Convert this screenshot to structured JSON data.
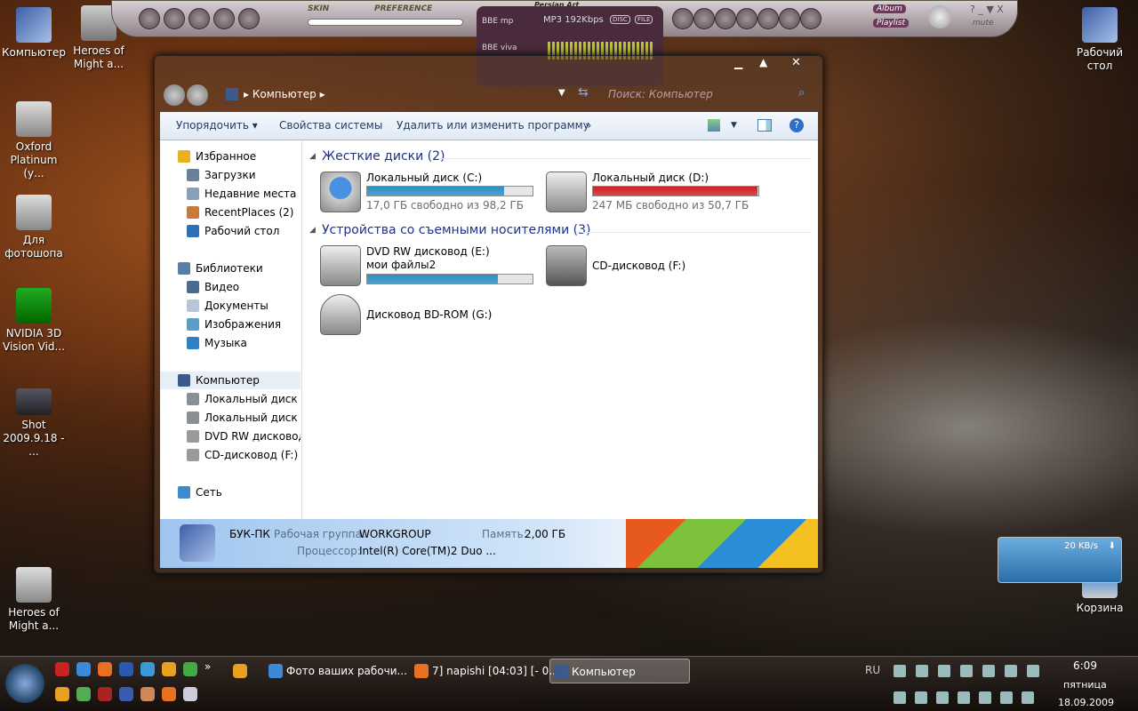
{
  "desktop": {
    "icons_left": [
      "Компьютер",
      "Oxford Platinum (у...",
      "Для фотошопа",
      "NVIDIA 3D Vision Vid...",
      "Shot 2009.9.18 - ...",
      "Heroes of Might a..."
    ],
    "icon_second": "Heroes of Might a...",
    "icons_right": [
      "Рабочий стол",
      "Корзина"
    ]
  },
  "player": {
    "skin": "SKIN",
    "preference": "PREFERENCE",
    "brand": "Persian Art",
    "bbe_mp": "BBE mp",
    "bbe_viva": "BBE viva",
    "format": "MP3 192Kbps",
    "disc": "DISC",
    "file": "FILE",
    "album": "Album",
    "playlist": "Playlist",
    "mute": "mute",
    "help": "? _ ▼ X"
  },
  "window": {
    "address": "Компьютер",
    "search_placeholder": "Поиск: Компьютер",
    "toolbar": {
      "organize": "Упорядочить ▾",
      "system_props": "Свойства системы",
      "uninstall": "Удалить или изменить программу",
      "more": "»"
    },
    "nav": [
      {
        "label": "Избранное",
        "icon": "star-icon",
        "color": "#e8b21e"
      },
      {
        "label": "Загрузки",
        "icon": "downloads-icon",
        "color": "#6b7f99"
      },
      {
        "label": "Недавние места",
        "icon": "recent-icon",
        "color": "#8aa0b8"
      },
      {
        "label": "RecentPlaces (2)",
        "icon": "recent-icon",
        "color": "#c77a3e"
      },
      {
        "label": "Рабочий стол",
        "icon": "desktop-icon",
        "color": "#2f6fb5"
      },
      {
        "label": "Библиотеки",
        "icon": "library-icon",
        "color": "#5a7da6"
      },
      {
        "label": "Видео",
        "icon": "video-icon",
        "color": "#4a6b8f"
      },
      {
        "label": "Документы",
        "icon": "documents-icon",
        "color": "#b9c6d6"
      },
      {
        "label": "Изображения",
        "icon": "pictures-icon",
        "color": "#5e9cc8"
      },
      {
        "label": "Музыка",
        "icon": "music-icon",
        "color": "#2f7fc4"
      },
      {
        "label": "Компьютер",
        "icon": "computer-icon",
        "color": "#3c5a8c"
      },
      {
        "label": "Локальный диск (C",
        "icon": "drive-icon",
        "color": "#8a8f96"
      },
      {
        "label": "Локальный диск (D",
        "icon": "drive-icon",
        "color": "#8a8f96"
      },
      {
        "label": "DVD RW дисковод (",
        "icon": "dvd-icon",
        "color": "#9a9a9a"
      },
      {
        "label": "CD-дисковод (F:)",
        "icon": "cd-icon",
        "color": "#9a9a9a"
      },
      {
        "label": "Сеть",
        "icon": "network-icon",
        "color": "#3d8ad0"
      }
    ],
    "groups": [
      {
        "title": "Жесткие диски (2)"
      },
      {
        "title": "Устройства со съемными носителями (3)"
      }
    ],
    "drives": [
      {
        "name": "Локальный диск (C:)",
        "free": "17,0 ГБ свободно из 98,2 ГБ",
        "used_fraction": 0.83,
        "bar_color": "#2a8fc4"
      },
      {
        "name": "Локальный диск (D:)",
        "free": "247 МБ свободно из 50,7 ГБ",
        "used_fraction": 0.995,
        "bar_color": "#d42020"
      },
      {
        "name": "DVD RW дисковод (E:) мои файлы2",
        "used_fraction": 0.79,
        "bar_color": "#2a8fc4"
      },
      {
        "name": "CD-дисковод (F:)"
      },
      {
        "name": "Дисковод BD-ROM (G:)"
      }
    ],
    "details": {
      "pc": "БУК-ПК",
      "wg_label": "Рабочая группа:",
      "wg": "WORKGROUP",
      "mem_label": "Память:",
      "mem": "2,00 ГБ",
      "cpu_label": "Процессор:",
      "cpu": "Intel(R) Core(TM)2 Duo ..."
    }
  },
  "gadget": {
    "speed": "20 KB/s"
  },
  "taskbar": {
    "tasks": [
      "Фото ваших рабочи...",
      "7] napishi [04:03] [- 0...",
      "Компьютер"
    ],
    "lang": "RU",
    "time": "6:09",
    "day": "пятница",
    "date": "18.09.2009",
    "more": "»"
  }
}
